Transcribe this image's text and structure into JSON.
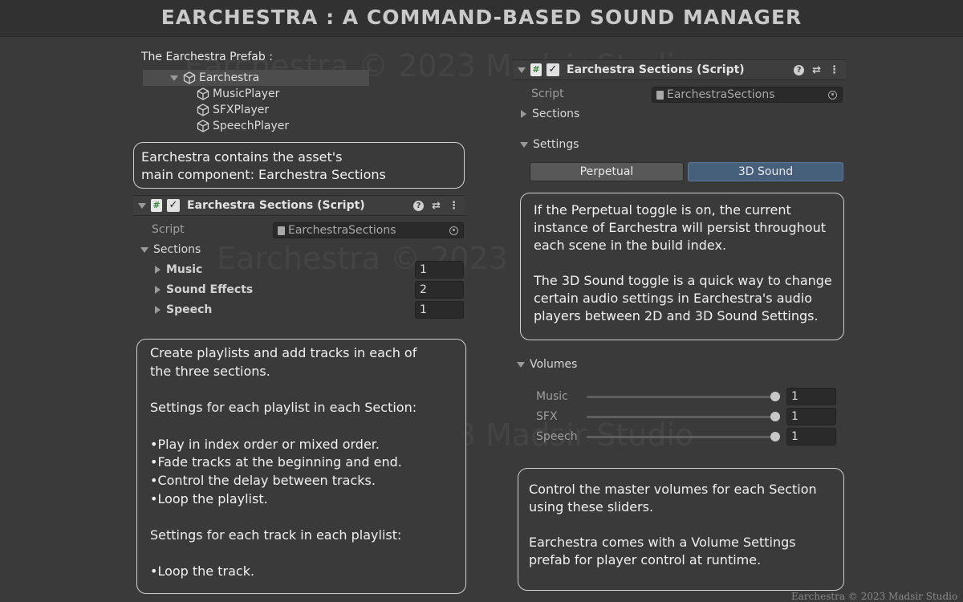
{
  "banner": {
    "title": "EARCHESTRA : A COMMAND-BASED SOUND MANAGER"
  },
  "watermark": "Earchestra © 2023 Madsir Studio",
  "hierarchy": {
    "caption": "The Earchestra Prefab :",
    "root": "Earchestra",
    "children": [
      "MusicPlayer",
      "SFXPlayer",
      "SpeechPlayer"
    ]
  },
  "callouts": {
    "main_component": "Earchestra contains the asset's\nmain component: Earchestra Sections",
    "playlists": "Create playlists and add tracks in each of\nthe three sections.\n\nSettings for each playlist in each Section:\n\n•Play in index order or mixed order.\n•Fade tracks at the beginning and end.\n•Control the delay between tracks.\n•Loop the playlist.\n\nSettings for each track in each playlist:\n\n•Loop the track.",
    "toggles": "If the Perpetual toggle is on, the current\ninstance of Earchestra will persist throughout\neach scene in the build index.\n\nThe 3D Sound toggle is a quick way to change\ncertain audio settings in Earchestra's audio\nplayers between 2D and 3D Sound Settings.",
    "volumes": "Control the master volumes for each Section\nusing these sliders.\n\nEarchestra comes with a Volume Settings\nprefab for player control at runtime."
  },
  "left_inspector": {
    "header_title": "Earchestra Sections (Script)",
    "script_label": "Script",
    "script_value": "EarchestraSections",
    "sections_label": "Sections",
    "rows": [
      {
        "label": "Music",
        "value": "1"
      },
      {
        "label": "Sound Effects",
        "value": "2"
      },
      {
        "label": "Speech",
        "value": "1"
      }
    ]
  },
  "right_inspector": {
    "header_title": "Earchestra Sections (Script)",
    "script_label": "Script",
    "script_value": "EarchestraSections",
    "sections_label": "Sections",
    "settings_label": "Settings",
    "toggle_perpetual": "Perpetual",
    "toggle_3d": "3D Sound",
    "toggle_perpetual_on": false,
    "toggle_3d_on": true,
    "volumes_label": "Volumes",
    "volumes": [
      {
        "label": "Music",
        "value": "1",
        "level": 1.0
      },
      {
        "label": "SFX",
        "value": "1",
        "level": 1.0
      },
      {
        "label": "Speech",
        "value": "1",
        "level": 1.0
      }
    ]
  },
  "footer": "Earchestra © 2023 Madsir Studio",
  "colors": {
    "background": "#3a3a3a",
    "toggle_active": "#46607c",
    "script_icon_green": "#3a8a3a"
  }
}
